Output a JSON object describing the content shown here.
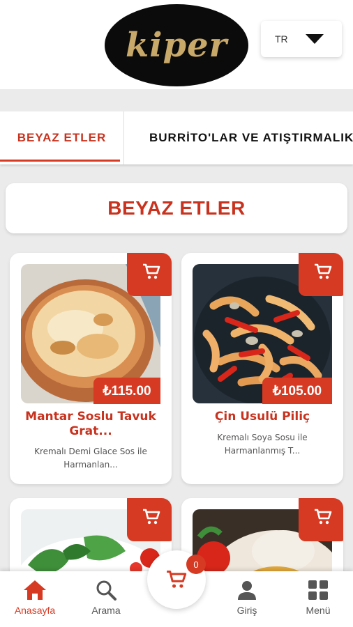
{
  "header": {
    "logo_text": "kiper",
    "language": "TR"
  },
  "category_tabs": [
    {
      "label": "BEYAZ ETLER",
      "active": true
    },
    {
      "label": "BURRİTO'LAR VE ATIŞTIRMALIKLAR",
      "active": false
    }
  ],
  "section": {
    "title": "BEYAZ ETLER"
  },
  "products": [
    {
      "title": "Mantar Soslu Tavuk Grat...",
      "price": "₺115.00",
      "description": "Kremalı Demi Glace Sos ile Harmanlan..."
    },
    {
      "title": "Çin Usulü Piliç",
      "price": "₺105.00",
      "description": "Kremalı Soya Sosu ile Harmanlanmış T..."
    },
    {
      "title": "",
      "price": "",
      "description": ""
    },
    {
      "title": "",
      "price": "",
      "description": ""
    }
  ],
  "cart": {
    "count": "0"
  },
  "bottom_nav": [
    {
      "label": "Anasayfa",
      "icon": "home-icon",
      "active": true
    },
    {
      "label": "Arama",
      "icon": "search-icon",
      "active": false
    },
    {
      "label": "Giriş",
      "icon": "user-icon",
      "active": false
    },
    {
      "label": "Menü",
      "icon": "grid-icon",
      "active": false
    }
  ],
  "colors": {
    "accent": "#d63a22",
    "title_red": "#c8321e",
    "background": "#ebebeb"
  }
}
